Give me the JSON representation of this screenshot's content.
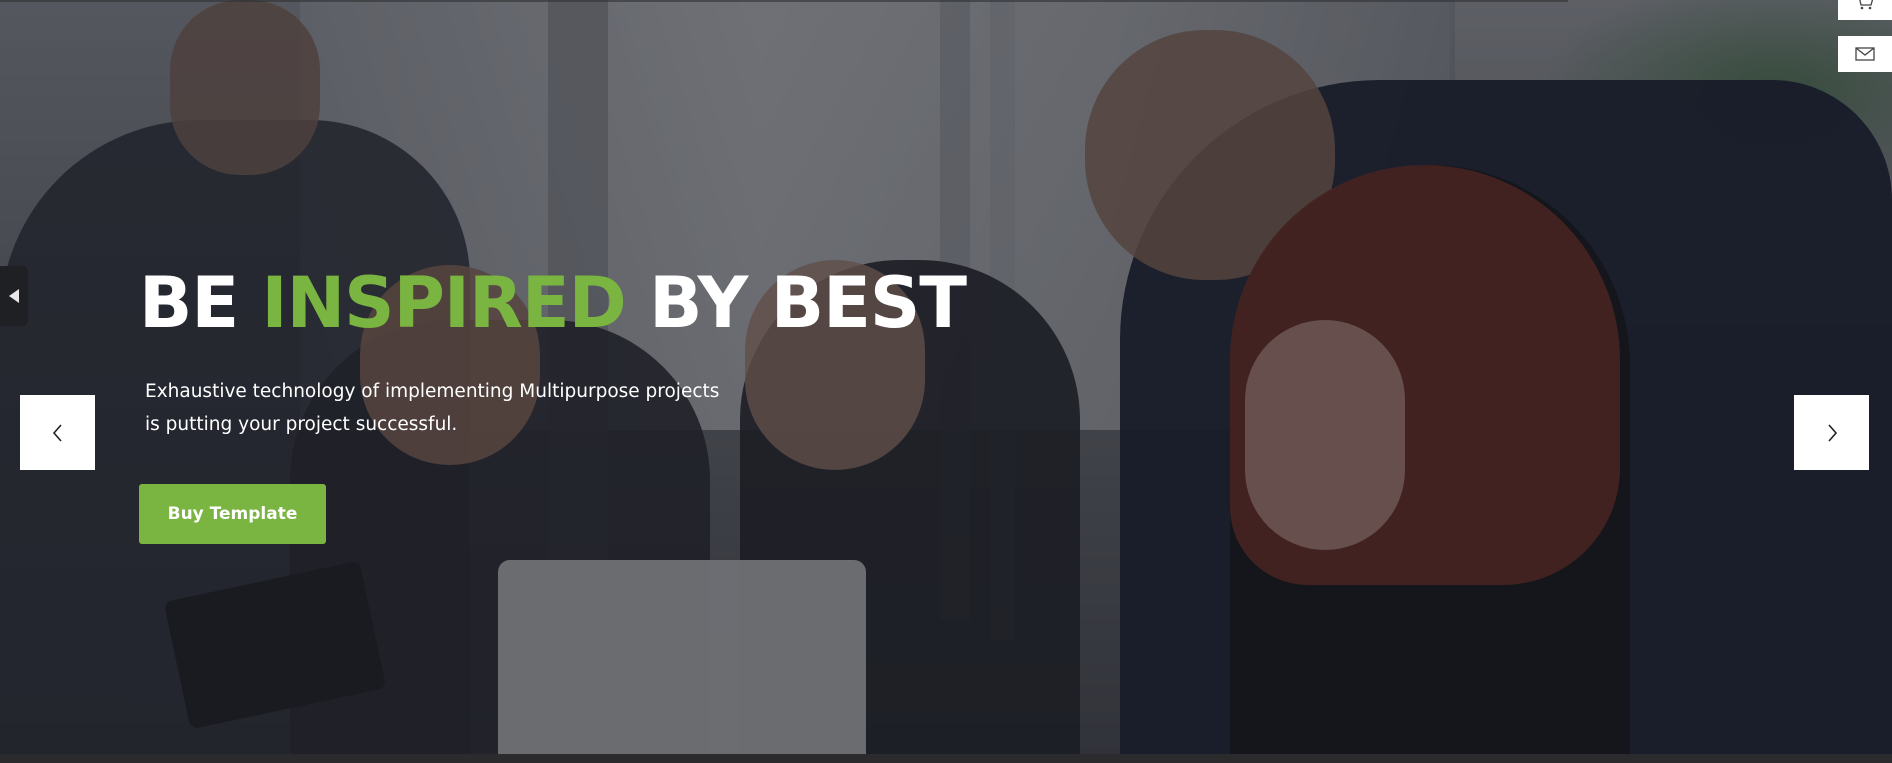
{
  "hero": {
    "headline": {
      "part1": "BE ",
      "accent": "INSPIRED",
      "part2": " BY BEST"
    },
    "subtitle": "Exhaustive technology of implementing Multipurpose projects is putting your project successful.",
    "cta_label": "Buy Template"
  },
  "navigation": {
    "prev_icon": "chevron-left-icon",
    "next_icon": "chevron-right-icon"
  },
  "floating_buttons": {
    "cart_icon": "cart-icon",
    "mail_icon": "mail-icon",
    "side_tab_icon": "caret-left-icon"
  },
  "colors": {
    "accent": "#7ab441",
    "text": "#ffffff",
    "button_text": "#ffffff"
  }
}
